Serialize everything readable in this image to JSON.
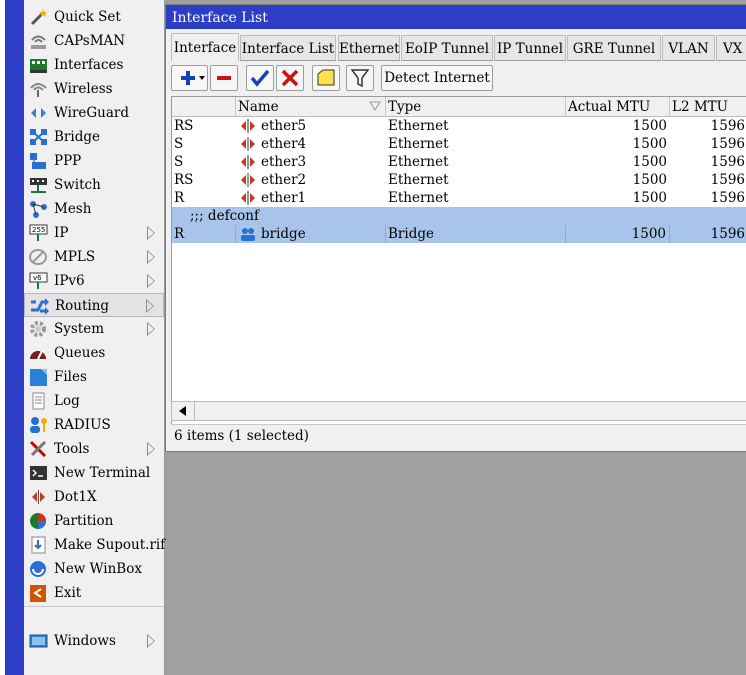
{
  "window": {
    "title": "Interface List"
  },
  "menu": {
    "items": [
      {
        "label": "Quick Set",
        "icon": "wand-icon",
        "submenu": false
      },
      {
        "label": "CAPsMAN",
        "icon": "capsman-icon",
        "submenu": false
      },
      {
        "label": "Interfaces",
        "icon": "interfaces-icon",
        "submenu": false
      },
      {
        "label": "Wireless",
        "icon": "wireless-icon",
        "submenu": false
      },
      {
        "label": "WireGuard",
        "icon": "wireguard-icon",
        "submenu": false
      },
      {
        "label": "Bridge",
        "icon": "bridge-icon",
        "submenu": false
      },
      {
        "label": "PPP",
        "icon": "ppp-icon",
        "submenu": false
      },
      {
        "label": "Switch",
        "icon": "switch-icon",
        "submenu": false
      },
      {
        "label": "Mesh",
        "icon": "mesh-icon",
        "submenu": false
      },
      {
        "label": "IP",
        "icon": "ip-icon",
        "submenu": true
      },
      {
        "label": "MPLS",
        "icon": "mpls-icon",
        "submenu": true
      },
      {
        "label": "IPv6",
        "icon": "ipv6-icon",
        "submenu": true
      },
      {
        "label": "Routing",
        "icon": "routing-icon",
        "submenu": true
      },
      {
        "label": "System",
        "icon": "system-gear-icon",
        "submenu": true
      },
      {
        "label": "Queues",
        "icon": "queues-icon",
        "submenu": false
      },
      {
        "label": "Files",
        "icon": "files-icon",
        "submenu": false
      },
      {
        "label": "Log",
        "icon": "log-icon",
        "submenu": false
      },
      {
        "label": "RADIUS",
        "icon": "radius-icon",
        "submenu": false
      },
      {
        "label": "Tools",
        "icon": "tools-icon",
        "submenu": true
      },
      {
        "label": "New Terminal",
        "icon": "terminal-icon",
        "submenu": false
      },
      {
        "label": "Dot1X",
        "icon": "dot1x-icon",
        "submenu": false
      },
      {
        "label": "Partition",
        "icon": "partition-icon",
        "submenu": false
      },
      {
        "label": "Make Supout.rif",
        "icon": "supout-icon",
        "submenu": false
      },
      {
        "label": "New WinBox",
        "icon": "winbox-icon",
        "submenu": false
      },
      {
        "label": "Exit",
        "icon": "exit-icon",
        "submenu": false
      }
    ],
    "windows": {
      "label": "Windows",
      "icon": "windows-icon",
      "submenu": true
    },
    "selected": "Routing"
  },
  "tabs": [
    "Interface",
    "Interface List",
    "Ethernet",
    "EoIP Tunnel",
    "IP Tunnel",
    "GRE Tunnel",
    "VLAN",
    "VX"
  ],
  "active_tab": "Interface",
  "toolbar": {
    "detect_label": "Detect Internet"
  },
  "table": {
    "columns": [
      "",
      "Name",
      "Type",
      "Actual MTU",
      "L2 MTU"
    ],
    "rows": [
      {
        "flags": "RS",
        "name": "ether5",
        "type": "Ethernet",
        "mtu": "1500",
        "l2mtu": "1596"
      },
      {
        "flags": "S",
        "name": "ether4",
        "type": "Ethernet",
        "mtu": "1500",
        "l2mtu": "1596"
      },
      {
        "flags": "S",
        "name": "ether3",
        "type": "Ethernet",
        "mtu": "1500",
        "l2mtu": "1596"
      },
      {
        "flags": "RS",
        "name": "ether2",
        "type": "Ethernet",
        "mtu": "1500",
        "l2mtu": "1596"
      },
      {
        "flags": "R",
        "name": "ether1",
        "type": "Ethernet",
        "mtu": "1500",
        "l2mtu": "1596"
      }
    ],
    "comment": ";;; defconf",
    "bridge_row": {
      "flags": "R",
      "name": "bridge",
      "type": "Bridge",
      "mtu": "1500",
      "l2mtu": "1596"
    }
  },
  "status": "6 items (1 selected)",
  "colors": {
    "title_bar": "#2c3ec6",
    "selection": "#a9c4ea"
  }
}
